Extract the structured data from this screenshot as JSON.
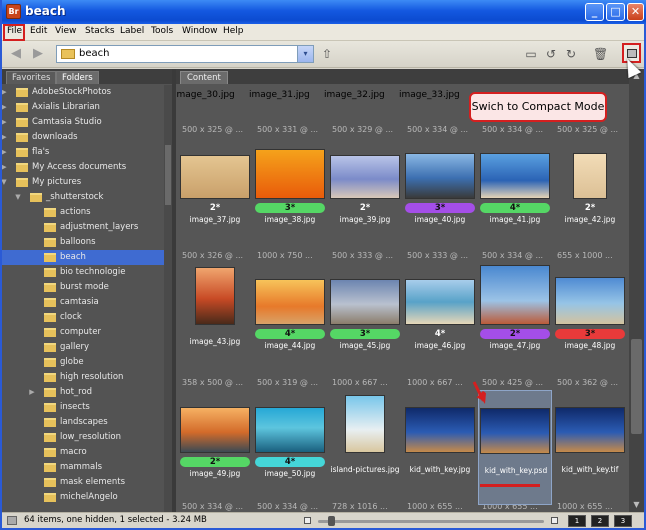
{
  "window": {
    "title": "beach",
    "app_badge": "Br",
    "minimize": "_",
    "maximize": "□",
    "close": "✕"
  },
  "menu": [
    "File",
    "Edit",
    "View",
    "Stacks",
    "Label",
    "Tools",
    "Window",
    "Help"
  ],
  "toolbar": {
    "path": "beach",
    "dropdown": "▾"
  },
  "panel_tabs": {
    "favorites": "Favorites",
    "folders": "Folders"
  },
  "tree": [
    {
      "label": "AdobeStockPhotos",
      "exp": "▶"
    },
    {
      "label": "Axialis Librarian",
      "exp": "▶"
    },
    {
      "label": "Camtasia Studio",
      "exp": "▶"
    },
    {
      "label": "downloads",
      "exp": "▶"
    },
    {
      "label": "fla's",
      "exp": "▶"
    },
    {
      "label": "My Access documents",
      "exp": "▶"
    },
    {
      "label": "My pictures",
      "exp": "▼"
    },
    {
      "label": "_shutterstock",
      "exp": "▼"
    },
    {
      "label": "actions",
      "exp": ""
    },
    {
      "label": "adjustment_layers",
      "exp": ""
    },
    {
      "label": "balloons",
      "exp": ""
    },
    {
      "label": "beach",
      "exp": "",
      "selected": true
    },
    {
      "label": "bio technologie",
      "exp": ""
    },
    {
      "label": "burst mode",
      "exp": ""
    },
    {
      "label": "camtasia",
      "exp": ""
    },
    {
      "label": "clock",
      "exp": ""
    },
    {
      "label": "computer",
      "exp": ""
    },
    {
      "label": "gallery",
      "exp": ""
    },
    {
      "label": "globe",
      "exp": ""
    },
    {
      "label": "high resolution",
      "exp": ""
    },
    {
      "label": "hot_rod",
      "exp": "▶"
    },
    {
      "label": "insects",
      "exp": ""
    },
    {
      "label": "landscapes",
      "exp": ""
    },
    {
      "label": "low_resolution",
      "exp": ""
    },
    {
      "label": "macro",
      "exp": ""
    },
    {
      "label": "mammals",
      "exp": ""
    },
    {
      "label": "mask elements",
      "exp": ""
    },
    {
      "label": "michelAngelo",
      "exp": ""
    }
  ],
  "content_tab": "Content",
  "top_row_files": [
    "image_30.jpg",
    "image_31.jpg",
    "image_32.jpg",
    "image_33.jpg"
  ],
  "dims_row1": [
    "500 x 325 @ ...",
    "500 x 331 @ ...",
    "500 x 329 @ ...",
    "500 x 334 @ ...",
    "500 x 334 @ ...",
    "500 x 325 @ ..."
  ],
  "row1": [
    {
      "file": "image_37.jpg",
      "rating": "2*",
      "label": "none"
    },
    {
      "file": "image_38.jpg",
      "rating": "3*",
      "label": "green"
    },
    {
      "file": "image_39.jpg",
      "rating": "2*",
      "label": "none"
    },
    {
      "file": "image_40.jpg",
      "rating": "3*",
      "label": "purple"
    },
    {
      "file": "image_41.jpg",
      "rating": "4*",
      "label": "green"
    },
    {
      "file": "image_42.jpg",
      "rating": "2*",
      "label": "none"
    }
  ],
  "dims_row2": [
    "500 x 326 @ ...",
    "1000 x 750 ...",
    "500 x 333 @ ...",
    "500 x 333 @ ...",
    "500 x 334 @ ...",
    "655 x 1000 ..."
  ],
  "row2": [
    {
      "file": "image_43.jpg",
      "rating": "",
      "label": "none"
    },
    {
      "file": "image_44.jpg",
      "rating": "4*",
      "label": "green"
    },
    {
      "file": "image_45.jpg",
      "rating": "3*",
      "label": "green"
    },
    {
      "file": "image_46.jpg",
      "rating": "4*",
      "label": "none"
    },
    {
      "file": "image_47.jpg",
      "rating": "2*",
      "label": "purple"
    },
    {
      "file": "image_48.jpg",
      "rating": "3*",
      "label": "red"
    }
  ],
  "dims_row3": [
    "358 x 500 @ ...",
    "500 x 319 @ ...",
    "1000 x 667 ...",
    "1000 x 667 ...",
    "500 x 425 @ ...",
    "500 x 362 @ ..."
  ],
  "row3": [
    {
      "file": "image_49.jpg",
      "rating": "2*",
      "label": "green"
    },
    {
      "file": "image_50.jpg",
      "rating": "4*",
      "label": "cyan"
    },
    {
      "file": "island-pictures.jpg",
      "rating": "",
      "label": "none"
    },
    {
      "file": "kid_with_key.jpg",
      "rating": "",
      "label": "none"
    },
    {
      "file": "kid_with_key.psd",
      "rating": "",
      "label": "none",
      "selected": true
    },
    {
      "file": "kid_with_key.tif",
      "rating": "",
      "label": "none"
    }
  ],
  "dims_row4": [
    "500 x 334 @ ...",
    "500 x 334 @ ...",
    "728 x 1016 ...",
    "1000 x 655 ...",
    "1000 x 655 ...",
    "1000 x 655 ..."
  ],
  "status": {
    "text": "64 items, one hidden, 1 selected - 3.24 MB",
    "view1": "1",
    "view2": "2",
    "view3": "3"
  },
  "callout": "Swich to Compact Mode",
  "colors": {
    "green": "#55d765",
    "purple": "#a44ee8",
    "red": "#e83a3a",
    "cyan": "#45d6d8",
    "accent": "#d41f1f",
    "selection": "#3f6bd1"
  }
}
